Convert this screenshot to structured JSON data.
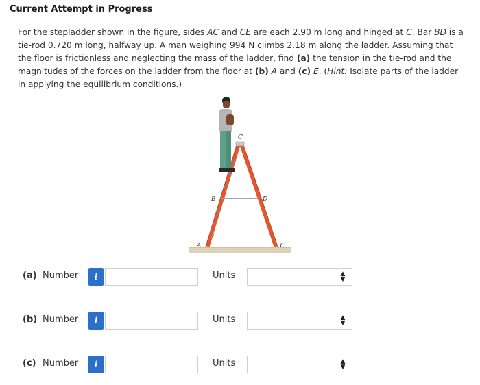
{
  "header": {
    "title": "Current Attempt in Progress"
  },
  "question": {
    "s1": "For the stepladder shown in the figure, sides ",
    "ac": "AC",
    "s2": " and ",
    "ce": "CE",
    "s3": " are each 2.90 m long and hinged at ",
    "c": "C",
    "s4": ". Bar ",
    "bd": "BD",
    "s5": " is a tie-rod 0.720 m long, halfway up. A man weighing 994 N climbs 2.18 m along the ladder. Assuming that the floor is frictionless and neglecting the mass of the ladder, find ",
    "pa": "(a)",
    "s6": " the tension in the tie-rod and the magnitudes of the forces on the ladder from the floor at ",
    "pb": "(b)",
    "s7": " ",
    "a": "A",
    "s8": " and ",
    "pc": "(c)",
    "s9": " ",
    "e": "E",
    "s10": ". (",
    "hint": "Hint:",
    "s11": " Isolate parts of the ladder in applying the equilibrium conditions.)"
  },
  "figure": {
    "labels": {
      "a": "A",
      "b": "B",
      "c": "C",
      "d": "D",
      "e": "E"
    },
    "colors": {
      "ladder": "#e4572e",
      "ladder_dark": "#b8401f",
      "floor": "#ddd2b8",
      "shirt": "#b5b5b5",
      "pants": "#5fa08a",
      "skin": "#7a4a30",
      "hair": "#222222"
    }
  },
  "answers": [
    {
      "label": "(a)",
      "word": "Number",
      "info": "i",
      "value": "",
      "units_word": "Units",
      "units_value": ""
    },
    {
      "label": "(b)",
      "word": "Number",
      "info": "i",
      "value": "",
      "units_word": "Units",
      "units_value": ""
    },
    {
      "label": "(c)",
      "word": "Number",
      "info": "i",
      "value": "",
      "units_word": "Units",
      "units_value": ""
    }
  ],
  "icons": {
    "info": "info-icon",
    "chevron": "up-down-chevron-icon"
  }
}
